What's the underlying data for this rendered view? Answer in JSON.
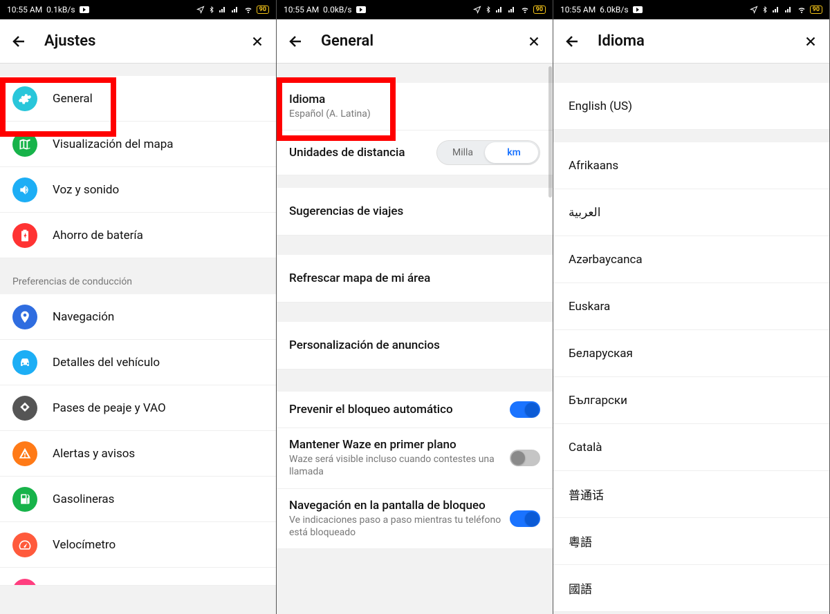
{
  "status": {
    "time": "10:55 AM",
    "rates": [
      "0.1kB/s",
      "0.0kB/s",
      "6.0kB/s"
    ],
    "battery": "90"
  },
  "screen1": {
    "title": "Ajustes",
    "items": [
      {
        "label": "General",
        "icon": "gear",
        "color": "#29c6da"
      },
      {
        "label": "Visualización del mapa",
        "icon": "map",
        "color": "#17b34a"
      },
      {
        "label": "Voz y sonido",
        "icon": "sound",
        "color": "#1daef5"
      },
      {
        "label": "Ahorro de batería",
        "icon": "battery",
        "color": "#ff3333"
      }
    ],
    "section_driving": "Preferencias de conducción",
    "driving": [
      {
        "label": "Navegación",
        "icon": "nav",
        "color": "#2f6de0"
      },
      {
        "label": "Detalles del vehículo",
        "icon": "car",
        "color": "#1daef5"
      },
      {
        "label": "Pases de peaje y VAO",
        "icon": "toll",
        "color": "#555"
      },
      {
        "label": "Alertas y avisos",
        "icon": "alert",
        "color": "#ff7a17"
      },
      {
        "label": "Gasolineras",
        "icon": "gas",
        "color": "#17b34a"
      },
      {
        "label": "Velocímetro",
        "icon": "speed",
        "color": "#ff5a3c"
      }
    ]
  },
  "screen2": {
    "title": "General",
    "language_label": "Idioma",
    "language_value": "Español (A. Latina)",
    "distance_label": "Unidades de distancia",
    "distance_options": [
      "Milla",
      "km"
    ],
    "distance_selected": "km",
    "trip_suggestions": "Sugerencias de viajes",
    "refresh_map": "Refrescar mapa de mi área",
    "ad_personalization": "Personalización de anuncios",
    "prevent_lock": {
      "title": "Prevenir el bloqueo automático",
      "on": true
    },
    "keep_foreground": {
      "title": "Mantener Waze en primer plano",
      "sub": "Waze será visible incluso cuando contestes una llamada",
      "on": false
    },
    "lock_nav": {
      "title": "Navegación en la pantalla de bloqueo",
      "sub": "Ve indicaciones paso a paso mientras tu teléfono está bloqueado",
      "on": true
    }
  },
  "screen3": {
    "title": "Idioma",
    "languages": [
      "English (US)",
      "Afrikaans",
      "العربية",
      "Azərbaycanca",
      "Euskara",
      "Беларуская",
      "Български",
      "Català",
      "普通话",
      "粵語",
      "國語"
    ]
  }
}
